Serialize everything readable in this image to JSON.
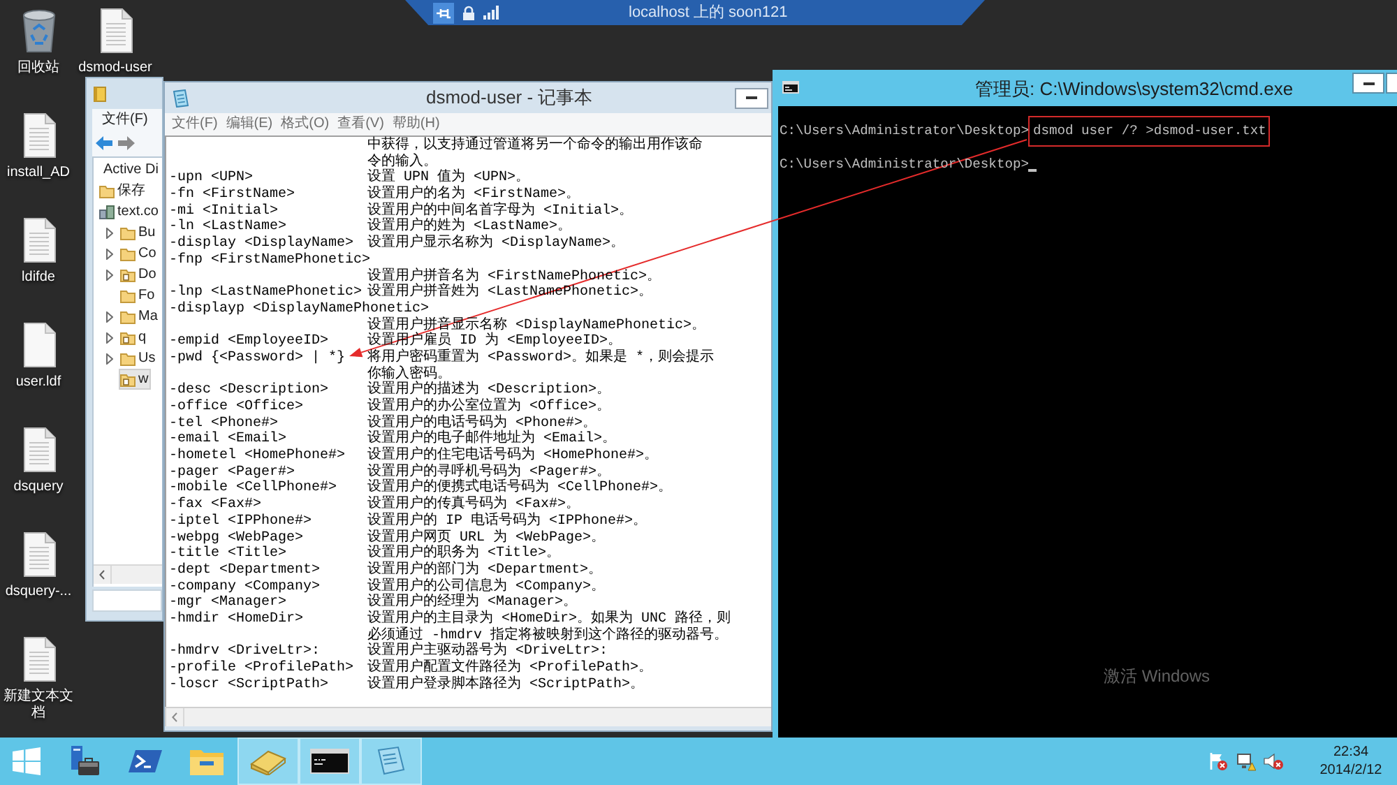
{
  "remote_bar": {
    "title": "localhost 上的 soon121"
  },
  "desktop_icons": [
    {
      "label": "回收站",
      "kind": "recycle-bin"
    },
    {
      "label": "install_AD",
      "kind": "text-file"
    },
    {
      "label": "ldifde",
      "kind": "text-file"
    },
    {
      "label": "user.ldf",
      "kind": "blank-file"
    },
    {
      "label": "dsquery",
      "kind": "text-file"
    },
    {
      "label": "dsquery-...",
      "kind": "text-file"
    },
    {
      "label": "新建文本文档",
      "kind": "text-file"
    },
    {
      "label": "dsmod-user",
      "kind": "text-file"
    }
  ],
  "explorer_window": {
    "menu": [
      "文件(F)"
    ],
    "tree": [
      {
        "label": "Active Di",
        "selected": false,
        "children": [
          {
            "label": "保存",
            "kind": "folder",
            "expandable": false,
            "selected": false
          },
          {
            "label": "text.co",
            "kind": "domain",
            "expandable": false,
            "selected": false,
            "children": [
              {
                "label": "Bu",
                "kind": "folder",
                "expandable": true,
                "selected": false
              },
              {
                "label": "Co",
                "kind": "folder",
                "expandable": true,
                "selected": false
              },
              {
                "label": "Do",
                "kind": "unit",
                "expandable": true,
                "selected": false
              },
              {
                "label": "Fo",
                "kind": "folder",
                "expandable": false,
                "selected": false
              },
              {
                "label": "Ma",
                "kind": "folder",
                "expandable": true,
                "selected": false
              },
              {
                "label": "q",
                "kind": "unit",
                "expandable": true,
                "selected": false
              },
              {
                "label": "Us",
                "kind": "folder",
                "expandable": true,
                "selected": false
              },
              {
                "label": "w",
                "kind": "unit",
                "expandable": false,
                "selected": true
              }
            ]
          }
        ]
      }
    ]
  },
  "notepad": {
    "title": "dsmod-user - 记事本",
    "menu": [
      "文件(F)",
      "编辑(E)",
      "格式(O)",
      "查看(V)",
      "帮助(H)"
    ],
    "lines": [
      {
        "description": "中获得，以支持通过管道将另一个命令的输出用作该命"
      },
      {
        "description": "令的输入。"
      },
      {
        "option": "-upn <UPN>",
        "description": "设置 UPN 值为 <UPN>。"
      },
      {
        "option": "-fn <FirstName>",
        "description": "设置用户的名为 <FirstName>。"
      },
      {
        "option": "-mi <Initial>",
        "description": "设置用户的中间名首字母为 <Initial>。"
      },
      {
        "option": "-ln <LastName>",
        "description": "设置用户的姓为 <LastName>。"
      },
      {
        "option": "-display <DisplayName>",
        "description": "设置用户显示名称为 <DisplayName>。"
      },
      {
        "option": "-fnp <FirstNamePhonetic>"
      },
      {
        "description": "设置用户拼音名为 <FirstNamePhonetic>。"
      },
      {
        "option": "-lnp <LastNamePhonetic>",
        "description": "设置用户拼音姓为 <LastNamePhonetic>。"
      },
      {
        "option": "-displayp <DisplayNamePhonetic>"
      },
      {
        "description": "设置用户拼音显示名称 <DisplayNamePhonetic>。"
      },
      {
        "option": "-empid <EmployeeID>",
        "description": "设置用户雇员 ID 为 <EmployeeID>。"
      },
      {
        "option": "-pwd {<Password> | *}",
        "description": "将用户密码重置为 <Password>。如果是 *，则会提示"
      },
      {
        "description": "你输入密码。"
      },
      {
        "option": "-desc <Description>",
        "description": "设置用户的描述为 <Description>。"
      },
      {
        "option": "-office <Office>",
        "description": "设置用户的办公室位置为 <Office>。"
      },
      {
        "option": "-tel <Phone#>",
        "description": "设置用户的电话号码为 <Phone#>。"
      },
      {
        "option": "-email <Email>",
        "description": "设置用户的电子邮件地址为 <Email>。"
      },
      {
        "option": "-hometel <HomePhone#>",
        "description": "设置用户的住宅电话号码为 <HomePhone#>。"
      },
      {
        "option": "-pager <Pager#>",
        "description": "设置用户的寻呼机号码为 <Pager#>。"
      },
      {
        "option": "-mobile <CellPhone#>",
        "description": "设置用户的便携式电话号码为 <CellPhone#>。"
      },
      {
        "option": "-fax <Fax#>",
        "description": "设置用户的传真号码为 <Fax#>。"
      },
      {
        "option": "-iptel <IPPhone#>",
        "description": "设置用户的 IP 电话号码为 <IPPhone#>。"
      },
      {
        "option": "-webpg <WebPage>",
        "description": "设置用户网页 URL 为 <WebPage>。"
      },
      {
        "option": "-title <Title>",
        "description": "设置用户的职务为 <Title>。"
      },
      {
        "option": "-dept <Department>",
        "description": "设置用户的部门为 <Department>。"
      },
      {
        "option": "-company <Company>",
        "description": "设置用户的公司信息为 <Company>。"
      },
      {
        "option": "-mgr <Manager>",
        "description": "设置用户的经理为 <Manager>。"
      },
      {
        "option": "-hmdir <HomeDir>",
        "description": "设置用户的主目录为 <HomeDir>。如果为 UNC 路径，则"
      },
      {
        "description": "必须通过 -hmdrv 指定将被映射到这个路径的驱动器号。"
      },
      {
        "option": "-hmdrv <DriveLtr>:",
        "description": "设置用户主驱动器号为 <DriveLtr>:"
      },
      {
        "option": "-profile <ProfilePath>",
        "description": "设置用户配置文件路径为 <ProfilePath>。"
      },
      {
        "option": "-loscr <ScriptPath>",
        "description": "设置用户登录脚本路径为 <ScriptPath>。"
      }
    ]
  },
  "cmd_window": {
    "title": "管理员: C:\\Windows\\system32\\cmd.exe",
    "lines": [
      {
        "prompt": "C:\\Users\\Administrator\\Desktop>",
        "command": "dsmod user /? >dsmod-user.txt",
        "highlighted": true,
        "cursor": false
      },
      {
        "prompt": "C:\\Users\\Administrator\\Desktop>",
        "highlighted": false,
        "cursor": true
      }
    ],
    "activation_notice": "激活 Windows"
  },
  "taskbar": {
    "apps": [
      {
        "kind": "server-manager",
        "running": false
      },
      {
        "kind": "powershell",
        "running": false
      },
      {
        "kind": "file-explorer",
        "running": false
      },
      {
        "kind": "directory-tool",
        "running": true
      },
      {
        "kind": "command-prompt",
        "running": true
      },
      {
        "kind": "notepad",
        "running": true
      }
    ],
    "clock": {
      "time": "22:34",
      "date": "2014/2/12"
    }
  }
}
